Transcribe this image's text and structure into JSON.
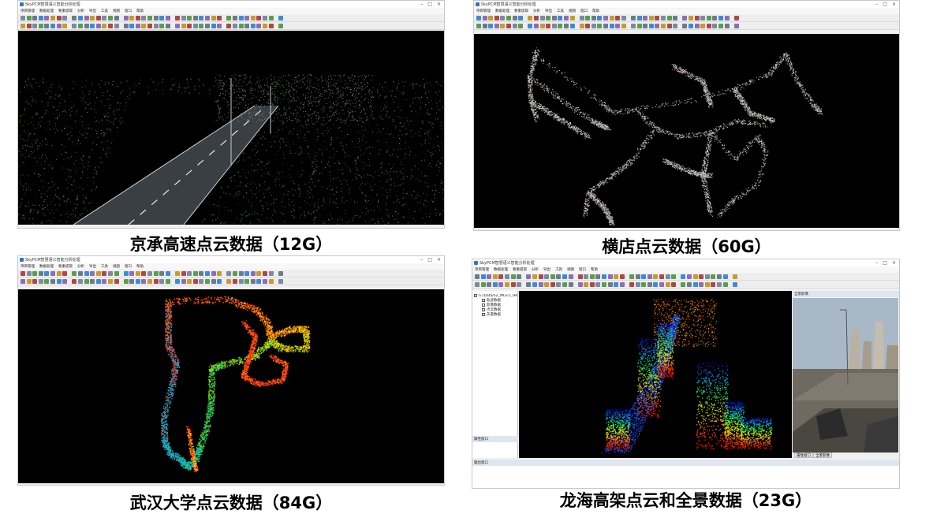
{
  "app": {
    "title": "SkyPCM智慧语义智能分析处理",
    "window_controls": [
      "–",
      "□",
      "×"
    ],
    "menu": [
      "项目管理",
      "数据处理",
      "要素提取",
      "分析",
      "导出",
      "工具",
      "视图",
      "窗口",
      "帮助"
    ]
  },
  "panels": [
    {
      "caption": "京承高速点云数据（12G）",
      "scene": "highway"
    },
    {
      "caption": "横店点云数据（60G）",
      "scene": "network"
    },
    {
      "caption": "武汉大学点云数据（84G）",
      "scene": "campus"
    },
    {
      "caption": "龙海高架点云和全景数据（23G）",
      "scene": "elevated"
    }
  ],
  "layer_tree": {
    "root": "G:/Data/SZ_MLS/1_HK",
    "items": [
      "轨迹数据",
      "影像数据",
      "点云数据",
      "矢量数据"
    ]
  },
  "side_panel_footer": "属性窗口",
  "bottom_panel_title": "输出窗口",
  "pano_header": "全景影像",
  "pano_tabs": [
    "属性窗口",
    "全景影像"
  ],
  "colors": {
    "viewport_bg": "#000000",
    "accent": "#2e74c9"
  }
}
